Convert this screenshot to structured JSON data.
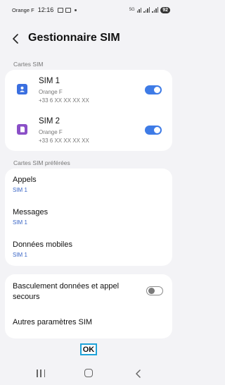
{
  "status_bar": {
    "carrier": "Orange F",
    "time": "12:16",
    "battery": "92",
    "network_label": "5G"
  },
  "header": {
    "title": "Gestionnaire SIM"
  },
  "sim_cards": {
    "section_label": "Cartes SIM",
    "items": [
      {
        "name": "SIM 1",
        "operator": "Orange F",
        "number": "+33 6 XX XX XX XX",
        "enabled": true,
        "icon_color": "#3a6fe0"
      },
      {
        "name": "SIM 2",
        "operator": "Orange F",
        "number": "+33 6 XX XX XX XX",
        "enabled": true,
        "icon_color": "#8a4fc7"
      }
    ]
  },
  "preferred": {
    "section_label": "Cartes SIM préférées",
    "items": [
      {
        "title": "Appels",
        "value": "SIM 1"
      },
      {
        "title": "Messages",
        "value": "SIM 1"
      },
      {
        "title": "Données mobiles",
        "value": "SIM 1"
      }
    ]
  },
  "other": {
    "fallback_label": "Basculement données et appel secours",
    "fallback_enabled": false,
    "more_settings_label": "Autres paramètres SIM"
  },
  "ok_button": "OK",
  "colors": {
    "accent": "#3e7be6",
    "link": "#3a66c6",
    "background": "#f3f3f6",
    "ok_focus_border": "#1fa2d8"
  }
}
